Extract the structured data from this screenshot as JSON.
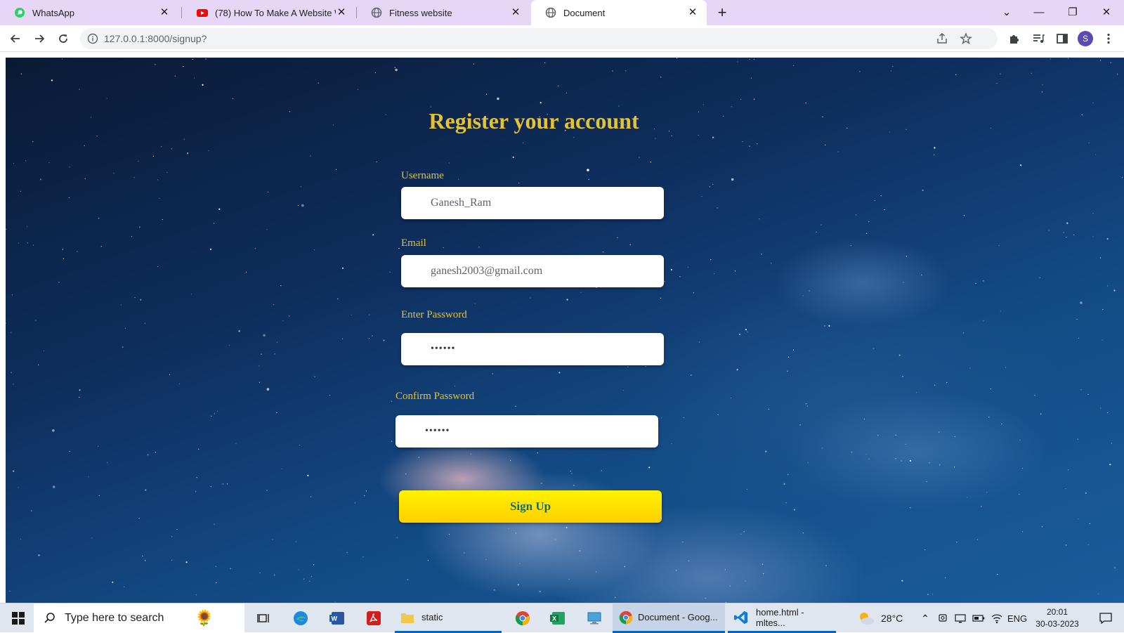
{
  "browser": {
    "tabs": [
      {
        "title": "WhatsApp",
        "icon": "whatsapp-icon"
      },
      {
        "title": "(78) How To Make A Website Wit",
        "icon": "youtube-icon"
      },
      {
        "title": "Fitness website",
        "icon": "globe-icon"
      },
      {
        "title": "Document",
        "icon": "globe-icon",
        "active": true
      }
    ],
    "url": "127.0.0.1:8000/signup?",
    "profile_initial": "S"
  },
  "page": {
    "heading": "Register your account",
    "fields": {
      "username": {
        "label": "Username",
        "value": "Ganesh_Ram"
      },
      "email": {
        "label": "Email",
        "value": "ganesh2003@gmail.com"
      },
      "password": {
        "label": "Enter Password",
        "value": "••••••"
      },
      "confirm_password": {
        "label": "Confirm Password",
        "value": "••••••"
      }
    },
    "submit_label": "Sign Up",
    "colors": {
      "accent": "#e6c22e",
      "button": "#ffe600",
      "button_text": "#1a6b63"
    }
  },
  "taskbar": {
    "search_placeholder": "Type here to search",
    "items": [
      {
        "label": "static",
        "icon": "folder-icon"
      },
      {
        "label": "Document - Goog...",
        "icon": "chrome-icon"
      },
      {
        "label": "home.html - mltes...",
        "icon": "vscode-icon"
      }
    ],
    "weather": "28°C",
    "language": "ENG",
    "time": "20:01",
    "date": "30-03-2023"
  }
}
